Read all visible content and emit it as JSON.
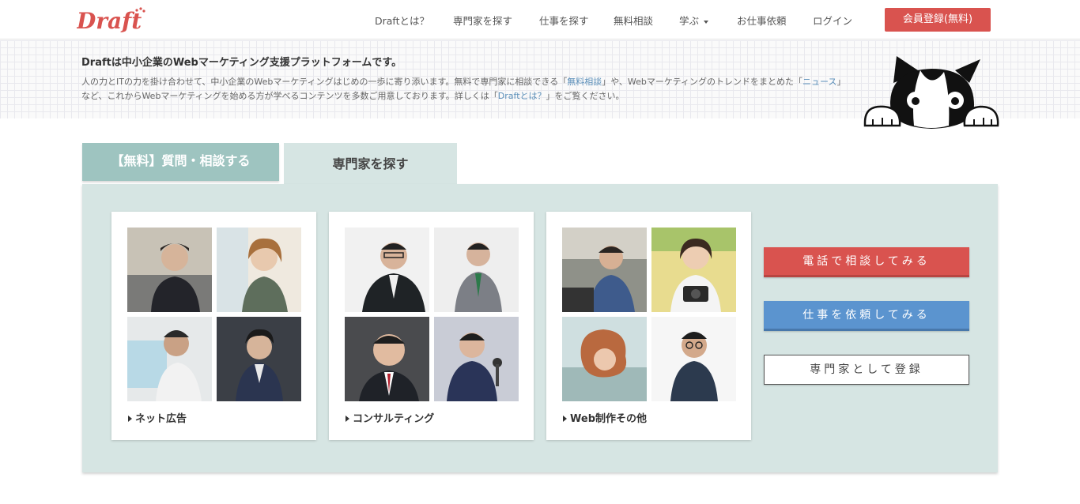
{
  "header": {
    "logo_text": "Draft",
    "nav": [
      {
        "label": "Draftとは？",
        "id": "about"
      },
      {
        "label": "専門家を探す",
        "id": "find-experts"
      },
      {
        "label": "仕事を探す",
        "id": "find-jobs"
      },
      {
        "label": "無料相談",
        "id": "free-consult"
      },
      {
        "label": "学ぶ",
        "id": "learn",
        "dropdown": true
      },
      {
        "label": "お仕事依頼",
        "id": "job-request"
      },
      {
        "label": "ログイン",
        "id": "login"
      }
    ],
    "signup_label": "会員登録(無料)"
  },
  "intro": {
    "title": "Draftは中小企業のWebマーケティング支援プラットフォームです。",
    "text_1": "人の力とITの力を掛け合わせて、中小企業のWebマーケティングはじめの一歩に寄り添います。無料で専門家に相談できる「",
    "link_free": "無料相談",
    "text_2": "」や、Webマーケティングのトレンドをまとめた「",
    "link_news": "ニュース",
    "text_3": "」など、これからWebマーケティングを始める方が学べるコンテンツを多数ご用意しております。詳しくは「",
    "link_about": "Draftとは？",
    "text_4": "」をご覧ください。"
  },
  "tabs": {
    "free_label": "【無料】質問・相談する",
    "experts_label": "専門家を探す"
  },
  "cards": [
    {
      "label": "ネット広告"
    },
    {
      "label": "コンサルティング"
    },
    {
      "label": "Web制作その他"
    }
  ],
  "actions": {
    "phone": "電話で相談してみる",
    "request": "仕事を依頼してみる",
    "register": "専門家として登録"
  },
  "colors": {
    "brand_red": "#d9534f",
    "action_blue": "#5b94cf",
    "panel_bg": "#d6e5e3",
    "tab_active": "#9ec4c0",
    "link": "#5b8fb9"
  }
}
